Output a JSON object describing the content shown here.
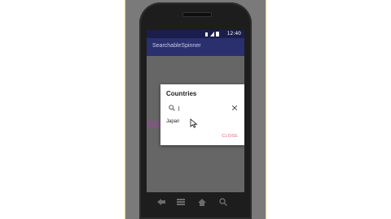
{
  "app": {
    "title": "SearchableSpinner"
  },
  "status_bar": {
    "time": "12:40"
  },
  "dialog": {
    "title": "Countries",
    "search": {
      "value": "j",
      "placeholder": ""
    },
    "results": [
      {
        "label": "Japan"
      }
    ],
    "close_label": "CLOSE"
  },
  "icons": {
    "search": "search-icon",
    "clear": "close-icon",
    "back": "back-icon",
    "home": "home-icon",
    "recent": "recent-apps-icon",
    "menu": "menu-icon",
    "search_key": "search-key-icon"
  },
  "colors": {
    "accent": "#e26a86",
    "appbar": "#2a2f6e",
    "status_bar": "#1b1e4c"
  }
}
